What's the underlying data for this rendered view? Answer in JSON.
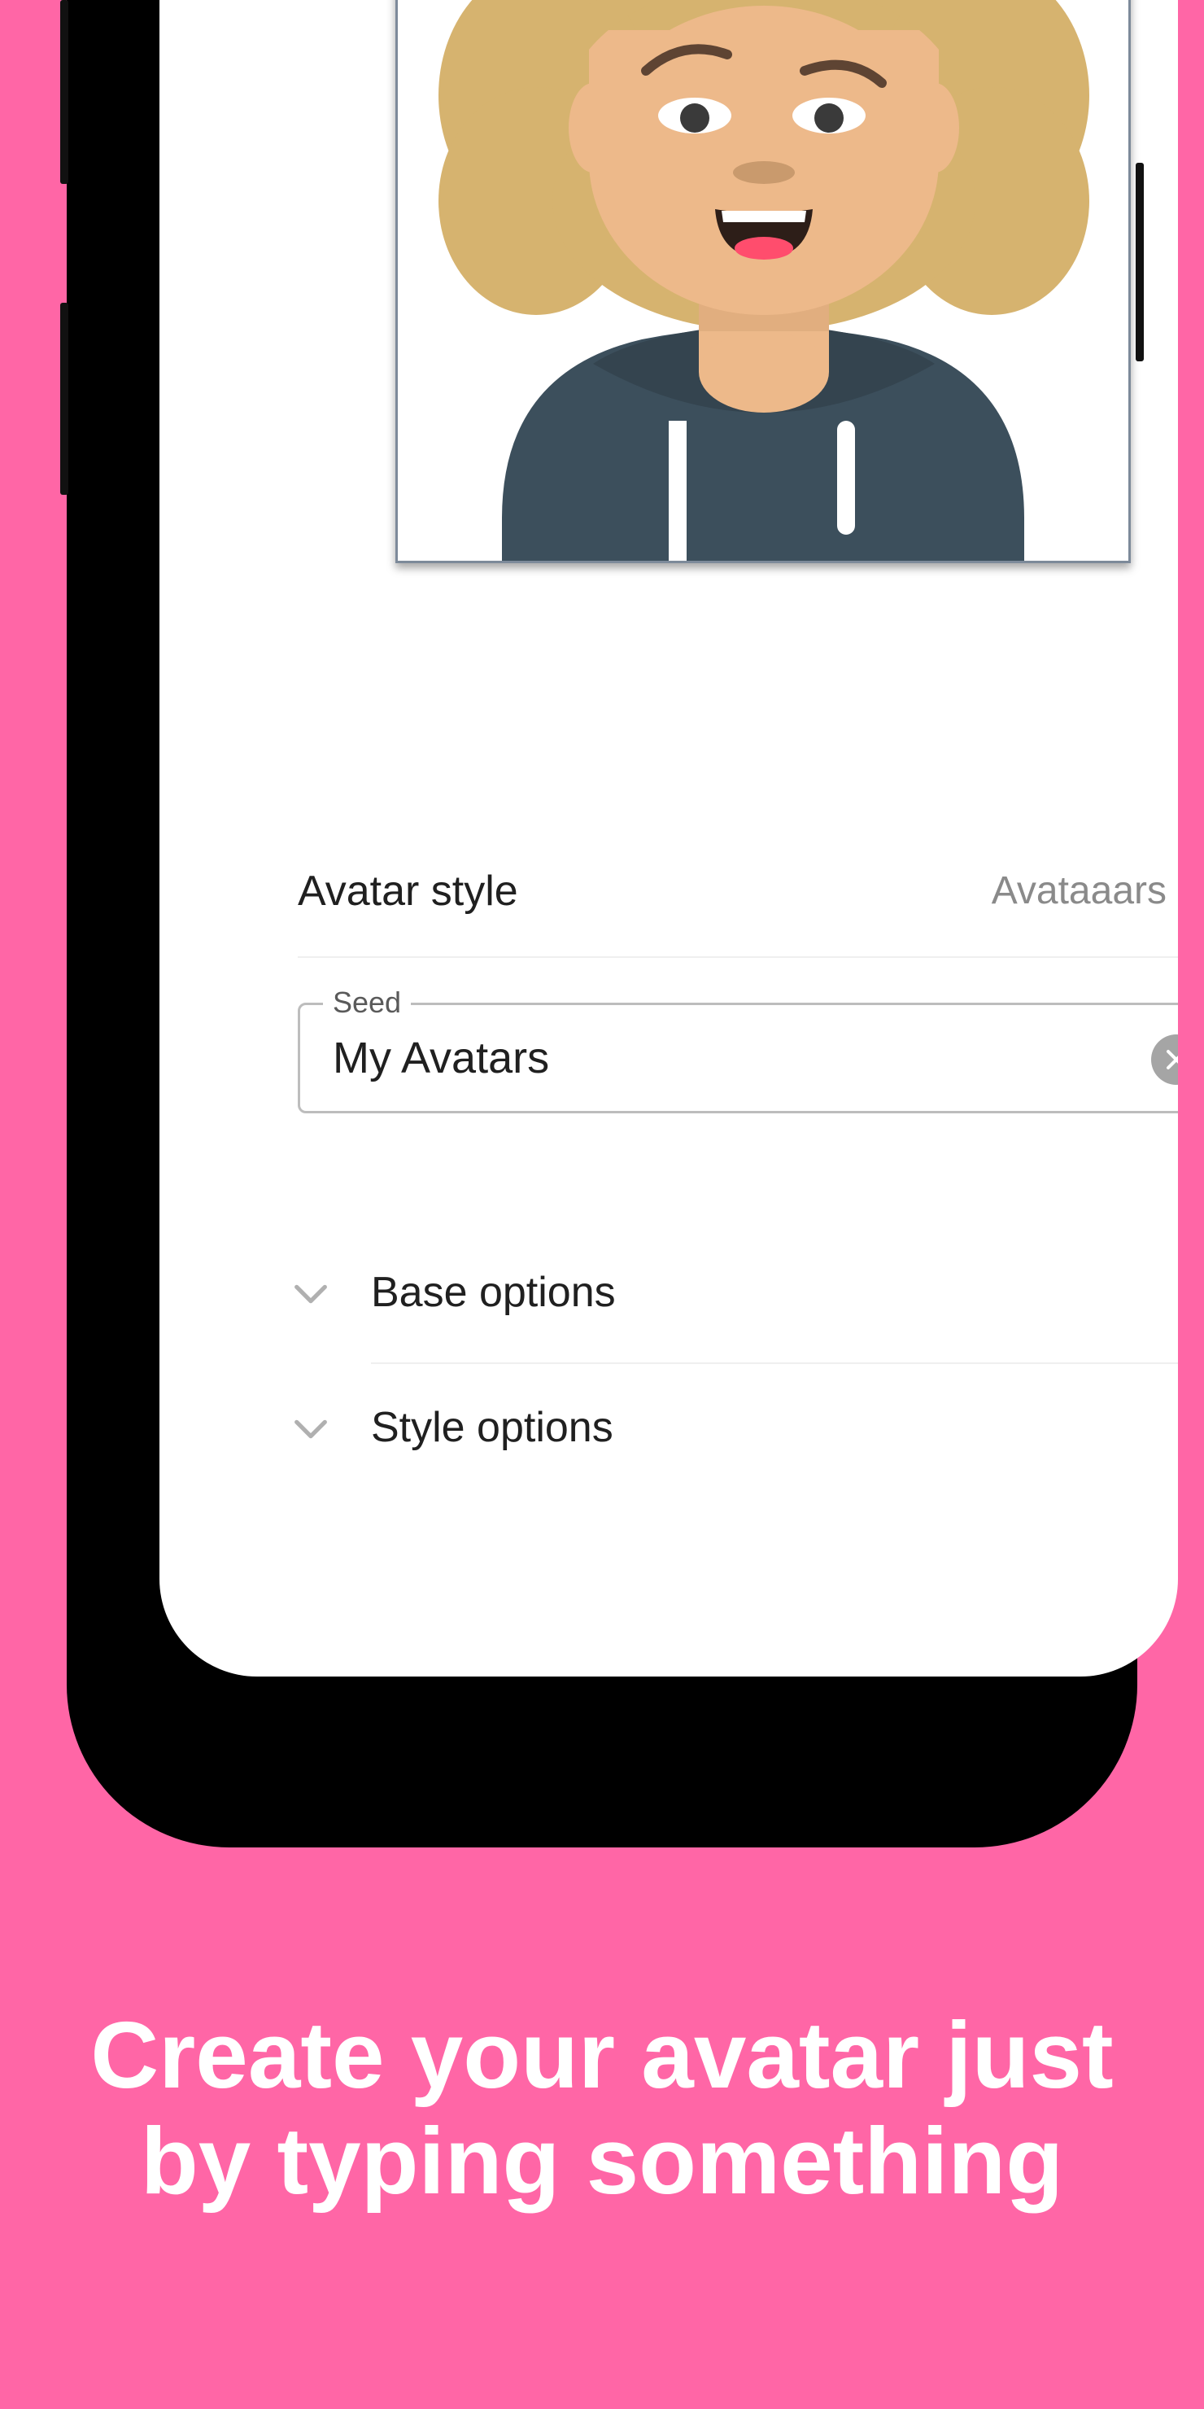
{
  "settings": {
    "avatar_style_label": "Avatar style",
    "avatar_style_value": "Avataaars"
  },
  "seed": {
    "label": "Seed",
    "value": "My Avatars"
  },
  "options": {
    "base_label": "Base options",
    "style_label": "Style options"
  },
  "caption": {
    "line1": "Create your avatar just",
    "line2": "by typing something"
  },
  "colors": {
    "background": "#ff66a6",
    "hair": "#d6b36f",
    "skin": "#edb98a",
    "hoodie": "#3c4f5c"
  },
  "icons": {
    "chevron_right": "chevron-right-icon",
    "clear": "clear-icon",
    "chevron_down": "chevron-down-icon"
  }
}
